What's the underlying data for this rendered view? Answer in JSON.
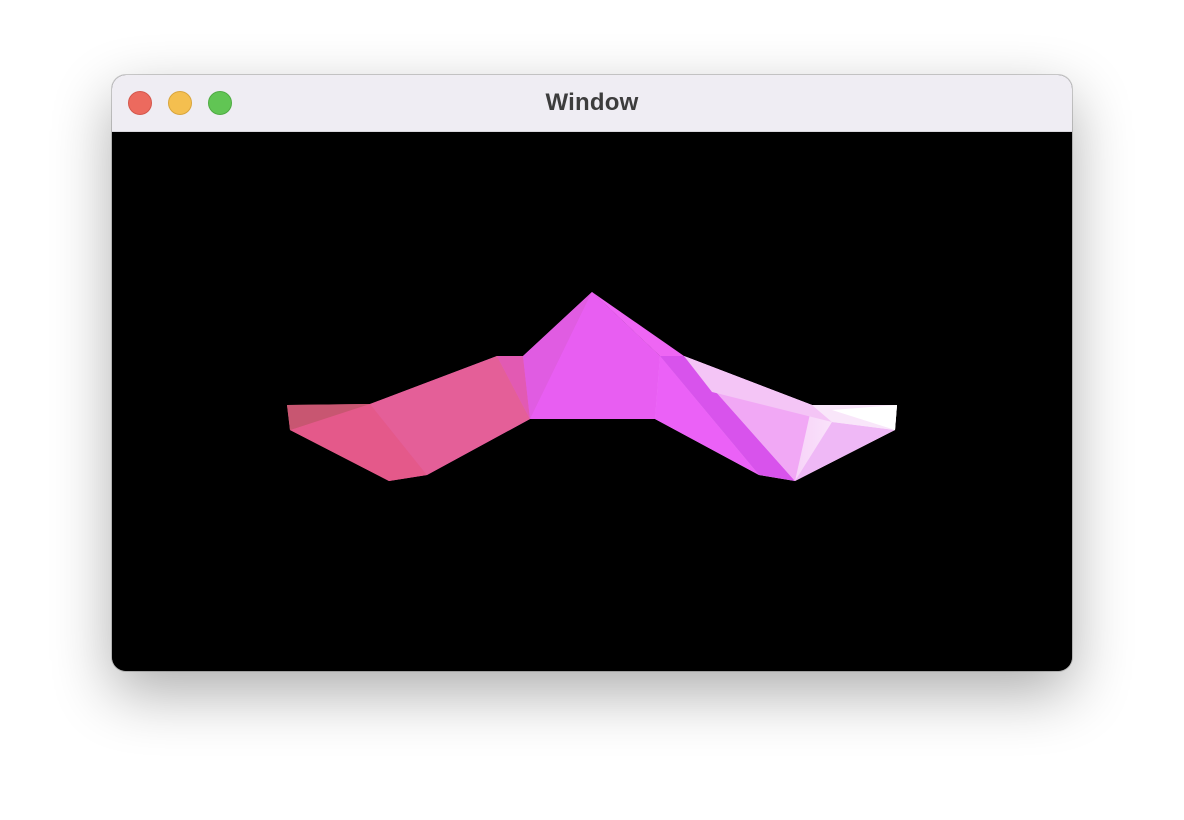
{
  "window": {
    "title": "Window",
    "controls": {
      "close": "close-button",
      "minimize": "minimize-button",
      "zoom": "zoom-button"
    }
  },
  "viewport": {
    "background": "#000000",
    "content": "3d-surface-mesh",
    "colors": {
      "left_edge": "#c25568",
      "left": "#e95c8a",
      "center": "#ea5ff1",
      "right": "#f4c5f6",
      "right_edge": "#ffffff"
    }
  }
}
